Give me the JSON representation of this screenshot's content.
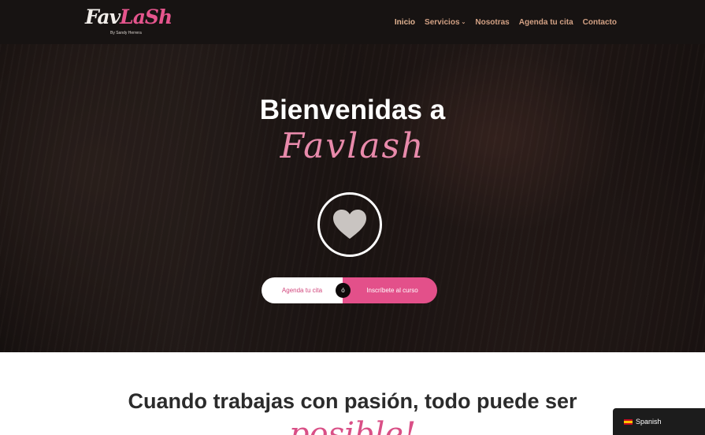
{
  "brand": {
    "logo_fav": "Fav",
    "logo_lash": "LaSh",
    "tagline": "By Sandy Herrera"
  },
  "nav": {
    "items": [
      {
        "label": "Inicio",
        "active": true
      },
      {
        "label": "Servicios",
        "caret": "⌄"
      },
      {
        "label": "Nosotras"
      },
      {
        "label": "Agenda tu cita"
      },
      {
        "label": "Contacto"
      }
    ]
  },
  "hero": {
    "title": "Bienvenidas a",
    "script": "Favlash",
    "icon": "heart-icon",
    "cta_primary": "Agenda tu cita",
    "cta_or": "ó",
    "cta_secondary": "Inscríbete al curso"
  },
  "section": {
    "headline": "Cuando trabajas con pasión, todo puede ser",
    "script": "posible!"
  },
  "language": {
    "label": "Spanish",
    "flag": "es-flag-icon"
  },
  "colors": {
    "nav_bg": "#171312",
    "nav_link": "#d3a184",
    "accent_pink": "#e3508a",
    "script_pink": "#e88aab"
  }
}
